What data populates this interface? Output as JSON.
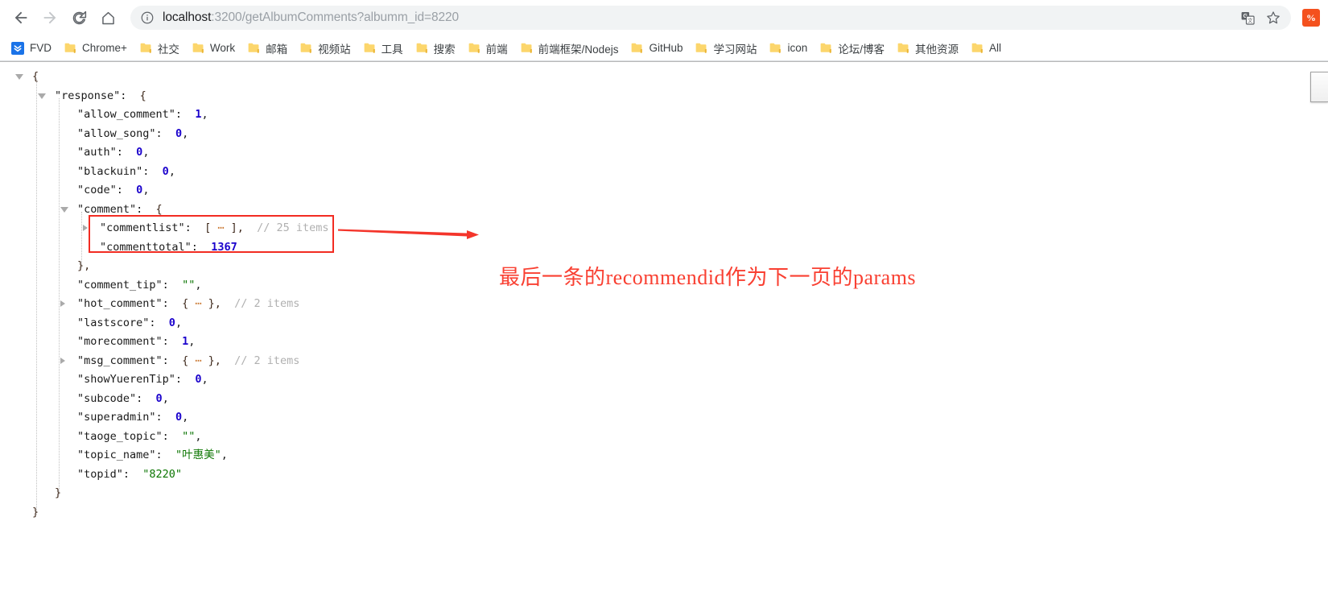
{
  "browser": {
    "nav": {
      "back_label": "Back",
      "forward_label": "Forward",
      "reload_label": "Reload",
      "home_label": "Home"
    },
    "omnibox": {
      "info_icon": "info-circle-icon",
      "url_host": "localhost",
      "url_rest": ":3200/getAlbumComments?albumm_id=8220",
      "full_url": "localhost:3200/getAlbumComments?albumm_id=8220",
      "translate_icon": "translate-icon",
      "bookmark_icon": "star-icon"
    },
    "extension": {
      "name": "percent-extension-icon",
      "glyph": "%",
      "color": "#f4511e"
    }
  },
  "bookmarks": [
    {
      "label": "FVD",
      "icon": "fvd-icon"
    },
    {
      "label": "Chrome+",
      "icon": "folder-icon"
    },
    {
      "label": "社交",
      "icon": "folder-icon"
    },
    {
      "label": "Work",
      "icon": "folder-icon"
    },
    {
      "label": "邮箱",
      "icon": "folder-icon"
    },
    {
      "label": "视频站",
      "icon": "folder-icon"
    },
    {
      "label": "工具",
      "icon": "folder-icon"
    },
    {
      "label": "搜索",
      "icon": "folder-icon"
    },
    {
      "label": "前端",
      "icon": "folder-icon"
    },
    {
      "label": "前端框架/Nodejs",
      "icon": "folder-icon"
    },
    {
      "label": "GitHub",
      "icon": "folder-icon"
    },
    {
      "label": "学习网站",
      "icon": "folder-icon"
    },
    {
      "label": "icon",
      "icon": "folder-icon"
    },
    {
      "label": "论坛/博客",
      "icon": "folder-icon"
    },
    {
      "label": "其他资源",
      "icon": "folder-icon"
    },
    {
      "label": "All",
      "icon": "folder-icon"
    }
  ],
  "json_viewer": {
    "lines": [
      {
        "indent": 0,
        "toggle": "open",
        "text": "{"
      },
      {
        "indent": 1,
        "toggle": "open",
        "key": "response",
        "text": "\"response\":  {"
      },
      {
        "indent": 2,
        "toggle": "none",
        "key": "allow_comment",
        "value": "1",
        "text": "\"allow_comment\":  1,"
      },
      {
        "indent": 2,
        "toggle": "none",
        "key": "allow_song",
        "value": "0",
        "text": "\"allow_song\":  0,"
      },
      {
        "indent": 2,
        "toggle": "none",
        "key": "auth",
        "value": "0",
        "text": "\"auth\":  0,"
      },
      {
        "indent": 2,
        "toggle": "none",
        "key": "blackuin",
        "value": "0",
        "text": "\"blackuin\":  0,"
      },
      {
        "indent": 2,
        "toggle": "none",
        "key": "code",
        "value": "0",
        "text": "\"code\":  0,"
      },
      {
        "indent": 2,
        "toggle": "open",
        "key": "comment",
        "text": "\"comment\":  {"
      },
      {
        "indent": 3,
        "toggle": "closed",
        "key": "commentlist",
        "value": "[ ... ],",
        "comment": "// 25 items",
        "text": "\"commentlist\":  [ ... ], // 25 items"
      },
      {
        "indent": 3,
        "toggle": "none",
        "key": "commenttotal",
        "value": "1367",
        "text": "\"commenttotal\":  1367"
      },
      {
        "indent": 2,
        "toggle": "none",
        "text": "},"
      },
      {
        "indent": 2,
        "toggle": "none",
        "key": "comment_tip",
        "value": "\"\"",
        "text": "\"comment_tip\":  \"\","
      },
      {
        "indent": 2,
        "toggle": "closed",
        "key": "hot_comment",
        "value": "{ ... },",
        "comment": "// 2 items",
        "text": "\"hot_comment\":  { ... }, // 2 items"
      },
      {
        "indent": 2,
        "toggle": "none",
        "key": "lastscore",
        "value": "0",
        "text": "\"lastscore\":  0,"
      },
      {
        "indent": 2,
        "toggle": "none",
        "key": "morecomment",
        "value": "1",
        "text": "\"morecomment\":  1,"
      },
      {
        "indent": 2,
        "toggle": "closed",
        "key": "msg_comment",
        "value": "{ ... },",
        "comment": "// 2 items",
        "text": "\"msg_comment\":  { ... }, // 2 items"
      },
      {
        "indent": 2,
        "toggle": "none",
        "key": "showYuerenTip",
        "value": "0",
        "text": "\"showYuerenTip\":  0,"
      },
      {
        "indent": 2,
        "toggle": "none",
        "key": "subcode",
        "value": "0",
        "text": "\"subcode\":  0,"
      },
      {
        "indent": 2,
        "toggle": "none",
        "key": "superadmin",
        "value": "0",
        "text": "\"superadmin\":  0,"
      },
      {
        "indent": 2,
        "toggle": "none",
        "key": "taoge_topic",
        "value": "\"\"",
        "text": "\"taoge_topic\":  \"\","
      },
      {
        "indent": 2,
        "toggle": "none",
        "key": "topic_name",
        "value": "\"叶惠美\"",
        "text": "\"topic_name\":  \"叶惠美\","
      },
      {
        "indent": 2,
        "toggle": "none",
        "key": "topid",
        "value": "\"8220\"",
        "text": "\"topid\":  \"8220\""
      },
      {
        "indent": 1,
        "toggle": "none",
        "text": "}"
      },
      {
        "indent": 0,
        "toggle": "none",
        "text": "}"
      }
    ],
    "labels": {
      "commentlist_key": "\"commentlist\"",
      "commentlist_sep": ":",
      "commentlist_val": "[ ⋯ ],",
      "commentlist_comment": "// 25 items",
      "commenttotal_key": "\"commenttotal\"",
      "commenttotal_sep": ":",
      "commenttotal_val": "1367"
    }
  },
  "annotation": {
    "text": "最后一条的recommendid作为下一页的params",
    "color": "#f94032",
    "highlight_box_color": "#f22c22",
    "arrow": "red-arrow-right"
  }
}
